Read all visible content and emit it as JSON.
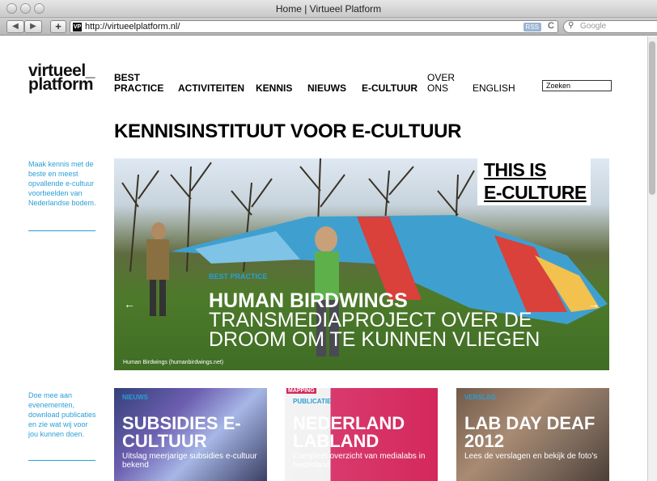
{
  "window": {
    "title": "Home | Virtueel Platform"
  },
  "toolbar": {
    "back": "◀",
    "forward": "▶",
    "add": "+",
    "favicon": "VP",
    "url": "http://virtueelplatform.nl/",
    "rss": "RSS",
    "reload": "C",
    "search_placeholder": "Google"
  },
  "site": {
    "logo_line1": "virtueel_",
    "logo_line2": "platform",
    "nav": {
      "best": "BEST",
      "practice": "PRACTICE",
      "activiteiten": "ACTIVITEITEN",
      "kennis": "KENNIS",
      "nieuws": "NIEUWS",
      "ecultuur": "E-CULTUUR",
      "over": "OVER",
      "ons": "ONS",
      "english": "ENGLISH"
    },
    "search_value": "Zoeken",
    "headline": "KENNISINSTITUUT VOOR E-CULTUUR"
  },
  "sidebar": {
    "intro": "Maak kennis met de beste en meest opvallende e-cultuur voorbeelden van Nederlandse bodem.",
    "join": "Doe mee aan evenementen, download publicaties en zie wat wij voor jou kunnen doen."
  },
  "hero": {
    "badge_line1": "THIS IS",
    "badge_line2": "E-CULTURE",
    "category": "BEST PRACTICE",
    "title": "HUMAN BIRDWINGS",
    "subtitle": "TRANSMEDIAPROJECT OVER DE DROOM OM TE KUNNEN VLIEGEN",
    "caption": "Human Birdwings (humanbirdwings.net)",
    "prev": "←",
    "next": "→"
  },
  "tiles": [
    {
      "category": "NIEUWS",
      "title": "SUBSIDIES E-CULTUUR",
      "subtitle": "Uitslag meerjarige subsidies e-cultuur bekend"
    },
    {
      "label": "MAPPING",
      "category": "PUBLICATIE",
      "title": "NEDERLAND LABLAND",
      "subtitle": "Compleet overzicht van medialabs in Nederland"
    },
    {
      "category": "VERSLAG",
      "title": "LAB DAY DEAF 2012",
      "subtitle": "Lees de verslagen en bekijk de foto's"
    }
  ]
}
